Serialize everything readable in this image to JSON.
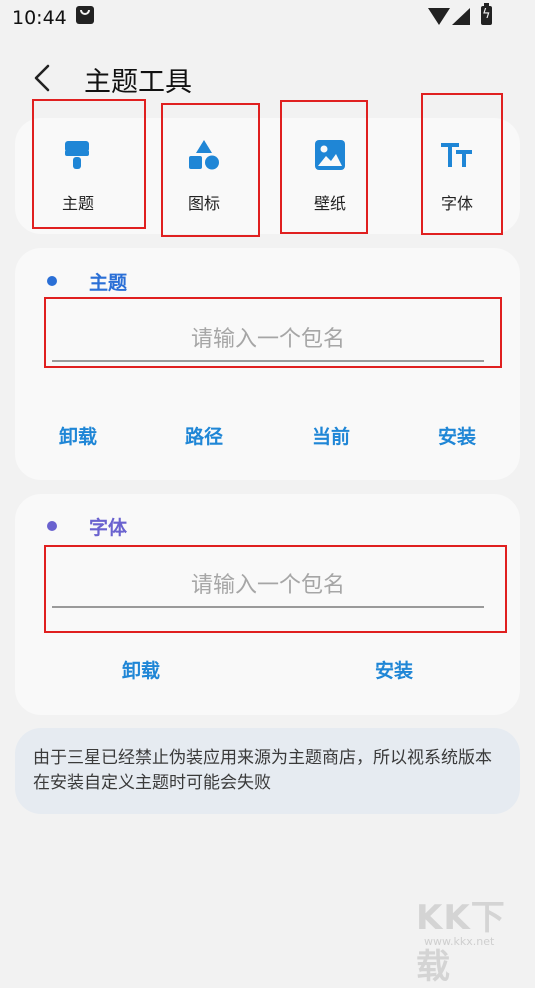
{
  "status_bar": {
    "time": "10:44"
  },
  "header": {
    "title": "主题工具"
  },
  "tools": [
    {
      "label": "主题",
      "icon": "paint-brush-icon"
    },
    {
      "label": "图标",
      "icon": "shapes-icon"
    },
    {
      "label": "壁纸",
      "icon": "image-icon"
    },
    {
      "label": "字体",
      "icon": "font-icon"
    }
  ],
  "theme_section": {
    "title": "主题",
    "input_placeholder": "请输入一个包名",
    "input_value": "",
    "actions": [
      "卸载",
      "路径",
      "当前",
      "安装"
    ]
  },
  "font_section": {
    "title": "字体",
    "input_placeholder": "请输入一个包名",
    "input_value": "",
    "actions": [
      "卸载",
      "安装"
    ]
  },
  "notice": {
    "text": "由于三星已经禁止伪装应用来源为主题商店，所以视系统版本在安装自定义主题时可能会失败"
  },
  "watermark": {
    "text": "KK下载",
    "sub": "www.kkx.net"
  },
  "colors": {
    "accent_blue": "#1f86d6",
    "theme_title": "#2a6fd6",
    "font_title": "#6a62cf",
    "theme_dot": "#2a6fd6",
    "font_dot": "#6a62cf",
    "highlight_box": "#e02020"
  }
}
